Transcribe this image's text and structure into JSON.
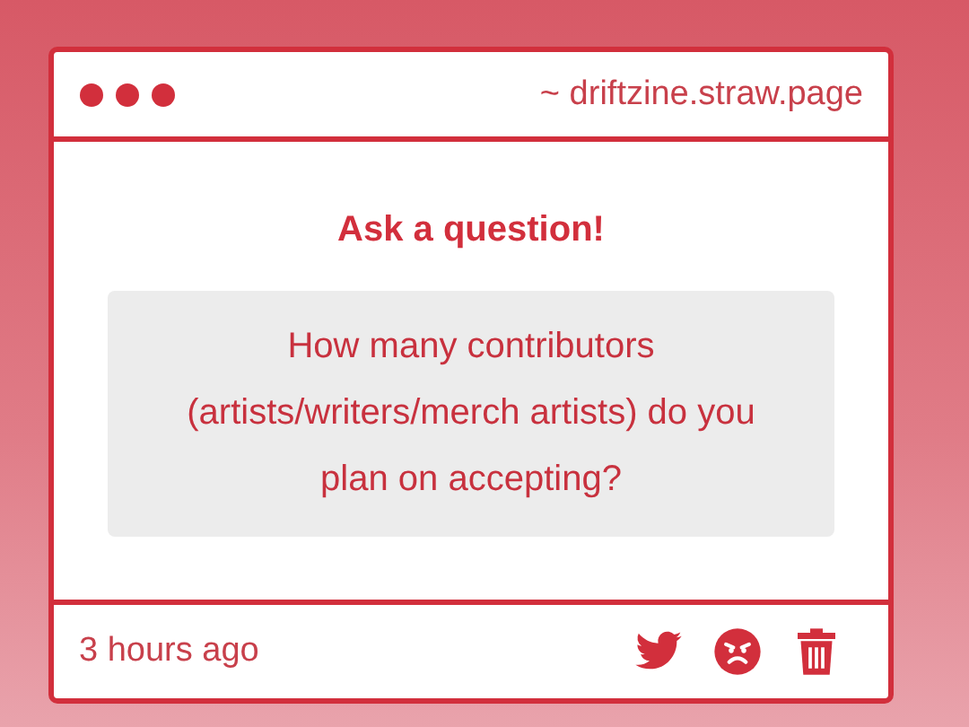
{
  "window": {
    "address": "~ driftzine.straw.page"
  },
  "heading": "Ask a question!",
  "question": "How many contributors (artists/writers/merch artists) do you plan on accepting?",
  "footer": {
    "time": "3 hours ago",
    "actions": [
      {
        "kind": "twitter"
      },
      {
        "kind": "angry"
      },
      {
        "kind": "delete"
      }
    ]
  }
}
